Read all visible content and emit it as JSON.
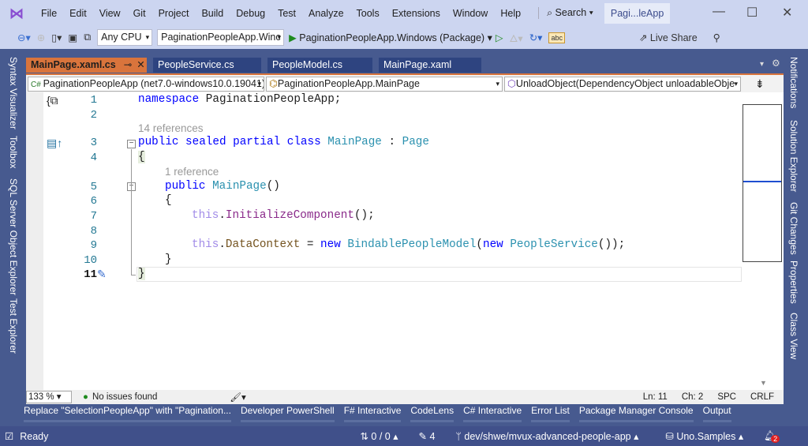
{
  "title_bar": {
    "menu": [
      "File",
      "Edit",
      "View",
      "Git",
      "Project",
      "Build",
      "Debug",
      "Test",
      "Analyze",
      "Tools",
      "Extensions",
      "Window",
      "Help"
    ],
    "search_label": "Search",
    "app_title": "Pagi...leApp"
  },
  "toolbar": {
    "platform": "Any CPU",
    "startup_project": "PaginationPeopleApp.Winc",
    "run_target": "PaginationPeopleApp.Windows (Package)",
    "live_share": "Live Share"
  },
  "left_panel_tabs": [
    "Syntax Visualizer",
    "Toolbox",
    "SQL Server Object Explorer",
    "Test Explorer"
  ],
  "right_panel_tabs": [
    "Notifications",
    "Solution Explorer",
    "Git Changes",
    "Properties",
    "Class View"
  ],
  "doc_tabs": [
    {
      "label": "MainPage.xaml.cs",
      "active": true
    },
    {
      "label": "PeopleService.cs"
    },
    {
      "label": "PeopleModel.cs"
    },
    {
      "label": "MainPage.xaml"
    }
  ],
  "nav_bar": {
    "project": "PaginationPeopleApp (net7.0-windows10.0.19041)",
    "type": "PaginationPeopleApp.MainPage",
    "member": "UnloadObject(DependencyObject unloadableObje"
  },
  "code": {
    "line_numbers": [
      "1",
      "2",
      "3",
      "4",
      "5",
      "6",
      "7",
      "8",
      "9",
      "10",
      "11"
    ],
    "refs_14": "14 references",
    "refs_1": "1 reference",
    "l1": {
      "kw": "namespace",
      "rest": " PaginationPeopleApp;"
    },
    "l3": {
      "kw": "public sealed partial class",
      "type": "MainPage",
      "sep": " : ",
      "base": "Page"
    },
    "l4": "{",
    "l5": {
      "kw": "public",
      "name": "MainPage",
      "rest": "()"
    },
    "l6": "{",
    "l7": {
      "this": "this",
      "dot": ".",
      "method": "InitializeComponent",
      "rest": "();"
    },
    "l9": {
      "this": "this",
      "dot": ".",
      "prop": "DataContext",
      "eq": " = ",
      "new1": "new",
      "type1": "BindablePeopleModel",
      "p1": "(",
      "new2": "new",
      "type2": "PeopleService",
      "p2": "());"
    },
    "l10": "}",
    "l11": "}"
  },
  "editor_status": {
    "zoom": "133 %",
    "issues": "No issues found",
    "line": "Ln: 11",
    "col": "Ch: 2",
    "whitespace": "SPC",
    "line_ending": "CRLF"
  },
  "tool_windows": [
    "Replace \"SelectionPeopleApp\" with \"Pagination...",
    "Developer PowerShell",
    "F# Interactive",
    "CodeLens",
    "C# Interactive",
    "Error List",
    "Package Manager Console",
    "Output"
  ],
  "status_bar": {
    "ready": "Ready",
    "updown": "0 / 0",
    "edits": "4",
    "branch": "dev/shwe/mvux-advanced-people-app",
    "repo": "Uno.Samples",
    "notifications": "2"
  }
}
